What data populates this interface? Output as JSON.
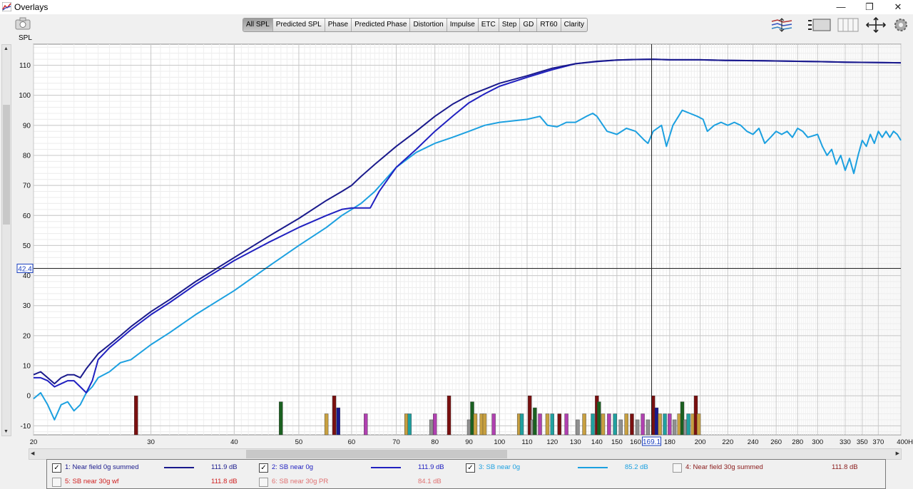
{
  "window": {
    "title": "Overlays",
    "buttons": {
      "minimize": "—",
      "restore": "❐",
      "close": "✕"
    }
  },
  "tabs": [
    {
      "label": "All SPL",
      "active": true
    },
    {
      "label": "Predicted SPL",
      "active": false
    },
    {
      "label": "Phase",
      "active": false
    },
    {
      "label": "Predicted Phase",
      "active": false
    },
    {
      "label": "Distortion",
      "active": false
    },
    {
      "label": "Impulse",
      "active": false
    },
    {
      "label": "ETC",
      "active": false
    },
    {
      "label": "Step",
      "active": false
    },
    {
      "label": "GD",
      "active": false
    },
    {
      "label": "RT60",
      "active": false
    },
    {
      "label": "Clarity",
      "active": false
    }
  ],
  "icons": [
    "camera-icon",
    "trace-arrange-icon",
    "controls-icon",
    "columns-icon",
    "move-icon",
    "gear-icon"
  ],
  "chart_data": {
    "type": "line",
    "ylabel": "SPL",
    "xscale": "log",
    "xlim": [
      20,
      400
    ],
    "ylim": [
      -13,
      117
    ],
    "yticks": [
      -10,
      0,
      10,
      20,
      30,
      40,
      50,
      60,
      70,
      80,
      90,
      100,
      110
    ],
    "xtick_labels": [
      "20",
      "30",
      "40",
      "50",
      "60",
      "70",
      "80",
      "90",
      "100",
      "110",
      "120",
      "130",
      "140",
      "150",
      "160",
      "180",
      "200",
      "220",
      "240",
      "260",
      "280",
      "300",
      "330",
      "350",
      "370",
      "400Hz"
    ],
    "xtick_values": [
      20,
      30,
      40,
      50,
      60,
      70,
      80,
      90,
      100,
      110,
      120,
      130,
      140,
      150,
      160,
      180,
      200,
      220,
      240,
      260,
      280,
      300,
      330,
      350,
      370,
      400
    ],
    "cursor": {
      "x": 169.1,
      "y": 42.4,
      "x_label": "169.1",
      "y_label": "42.4"
    },
    "grid": true,
    "series": [
      {
        "name": "1: Near field 0g summed",
        "color": "#1a1a8c",
        "points": [
          [
            20,
            7
          ],
          [
            20.5,
            8
          ],
          [
            21,
            6
          ],
          [
            21.5,
            4
          ],
          [
            22,
            6
          ],
          [
            22.5,
            7
          ],
          [
            23,
            7
          ],
          [
            23.5,
            6
          ],
          [
            24,
            9
          ],
          [
            25,
            14
          ],
          [
            26,
            17
          ],
          [
            27,
            20
          ],
          [
            28,
            23
          ],
          [
            30,
            28
          ],
          [
            32,
            32
          ],
          [
            35,
            38
          ],
          [
            40,
            46
          ],
          [
            45,
            53
          ],
          [
            50,
            59
          ],
          [
            55,
            65
          ],
          [
            58,
            68
          ],
          [
            60,
            70
          ],
          [
            62,
            73
          ],
          [
            65,
            77
          ],
          [
            70,
            83
          ],
          [
            75,
            88
          ],
          [
            80,
            93
          ],
          [
            85,
            97
          ],
          [
            90,
            100
          ],
          [
            95,
            102
          ],
          [
            100,
            104
          ],
          [
            110,
            106.5
          ],
          [
            120,
            109
          ],
          [
            130,
            110.5
          ],
          [
            140,
            111.3
          ],
          [
            150,
            111.7
          ],
          [
            160,
            111.9
          ],
          [
            170,
            112
          ],
          [
            180,
            111.8
          ],
          [
            190,
            111.8
          ],
          [
            200,
            111.8
          ],
          [
            220,
            111.6
          ],
          [
            250,
            111.5
          ],
          [
            280,
            111.3
          ],
          [
            300,
            111.2
          ],
          [
            330,
            111
          ],
          [
            370,
            110.9
          ],
          [
            400,
            110.8
          ]
        ]
      },
      {
        "name": "2: SB near 0g",
        "color": "#2020c0",
        "points": [
          [
            20,
            6
          ],
          [
            20.5,
            6
          ],
          [
            21,
            5
          ],
          [
            21.5,
            3
          ],
          [
            22,
            4
          ],
          [
            22.5,
            5
          ],
          [
            23,
            5
          ],
          [
            23.5,
            3
          ],
          [
            24,
            1
          ],
          [
            24.5,
            5
          ],
          [
            25,
            12
          ],
          [
            26,
            16
          ],
          [
            27,
            19
          ],
          [
            28,
            22
          ],
          [
            30,
            27
          ],
          [
            32,
            31
          ],
          [
            35,
            37
          ],
          [
            40,
            45
          ],
          [
            45,
            51
          ],
          [
            50,
            56
          ],
          [
            55,
            60
          ],
          [
            58,
            62
          ],
          [
            60,
            62.5
          ],
          [
            62,
            62.5
          ],
          [
            64,
            62.5
          ],
          [
            66,
            68
          ],
          [
            70,
            76
          ],
          [
            75,
            82
          ],
          [
            80,
            88
          ],
          [
            85,
            93
          ],
          [
            90,
            97.5
          ],
          [
            95,
            100.5
          ],
          [
            100,
            103
          ],
          [
            110,
            106
          ],
          [
            120,
            108.5
          ],
          [
            130,
            110.5
          ],
          [
            140,
            111.2
          ],
          [
            150,
            111.7
          ],
          [
            160,
            111.9
          ],
          [
            170,
            112
          ],
          [
            180,
            111.8
          ],
          [
            190,
            111.8
          ],
          [
            200,
            111.8
          ],
          [
            220,
            111.6
          ],
          [
            250,
            111.5
          ],
          [
            280,
            111.3
          ],
          [
            300,
            111.2
          ],
          [
            330,
            111
          ],
          [
            370,
            110.9
          ],
          [
            400,
            110.8
          ]
        ]
      },
      {
        "name": "3: SB near 0g",
        "color": "#1ca0e0",
        "points": [
          [
            20,
            -1
          ],
          [
            20.5,
            1
          ],
          [
            21,
            -3
          ],
          [
            21.5,
            -8
          ],
          [
            22,
            -3
          ],
          [
            22.5,
            -2
          ],
          [
            23,
            -5
          ],
          [
            23.5,
            -3
          ],
          [
            24,
            1
          ],
          [
            24.5,
            3
          ],
          [
            25,
            6
          ],
          [
            26,
            8
          ],
          [
            27,
            11
          ],
          [
            28,
            12
          ],
          [
            30,
            17
          ],
          [
            32,
            21
          ],
          [
            35,
            27
          ],
          [
            40,
            35
          ],
          [
            45,
            43
          ],
          [
            50,
            50
          ],
          [
            55,
            56
          ],
          [
            58,
            60
          ],
          [
            60,
            62
          ],
          [
            62,
            64
          ],
          [
            65,
            68
          ],
          [
            70,
            76
          ],
          [
            75,
            81
          ],
          [
            80,
            84
          ],
          [
            85,
            86
          ],
          [
            90,
            88
          ],
          [
            95,
            90
          ],
          [
            100,
            91
          ],
          [
            110,
            92
          ],
          [
            115,
            93
          ],
          [
            118,
            90
          ],
          [
            122,
            89.5
          ],
          [
            126,
            91
          ],
          [
            130,
            91
          ],
          [
            135,
            93
          ],
          [
            138,
            94
          ],
          [
            140,
            93
          ],
          [
            145,
            88
          ],
          [
            150,
            87
          ],
          [
            155,
            89
          ],
          [
            160,
            88
          ],
          [
            165,
            85
          ],
          [
            167,
            84
          ],
          [
            170,
            88
          ],
          [
            175,
            90
          ],
          [
            178,
            83
          ],
          [
            182,
            90
          ],
          [
            188,
            95
          ],
          [
            193,
            94
          ],
          [
            198,
            93
          ],
          [
            202,
            92
          ],
          [
            205,
            88
          ],
          [
            210,
            90
          ],
          [
            215,
            91
          ],
          [
            220,
            90
          ],
          [
            225,
            91
          ],
          [
            230,
            90
          ],
          [
            235,
            88
          ],
          [
            240,
            87
          ],
          [
            245,
            89
          ],
          [
            250,
            84
          ],
          [
            255,
            86
          ],
          [
            260,
            88
          ],
          [
            265,
            87
          ],
          [
            270,
            88
          ],
          [
            275,
            86
          ],
          [
            280,
            89
          ],
          [
            285,
            88
          ],
          [
            290,
            86
          ],
          [
            300,
            87
          ],
          [
            305,
            83
          ],
          [
            310,
            80
          ],
          [
            315,
            82
          ],
          [
            320,
            77
          ],
          [
            325,
            80
          ],
          [
            330,
            75
          ],
          [
            335,
            79
          ],
          [
            340,
            74
          ],
          [
            345,
            80
          ],
          [
            350,
            85
          ],
          [
            355,
            83
          ],
          [
            360,
            87
          ],
          [
            365,
            84
          ],
          [
            370,
            88
          ],
          [
            375,
            86
          ],
          [
            380,
            88
          ],
          [
            385,
            86
          ],
          [
            390,
            88
          ],
          [
            395,
            87
          ],
          [
            400,
            85
          ]
        ]
      }
    ],
    "bars": {
      "baseline": -13,
      "items": [
        {
          "x": 28.5,
          "top": 0,
          "color": "#7a1010"
        },
        {
          "x": 47,
          "top": -2,
          "color": "#1a6020"
        },
        {
          "x": 55,
          "top": -6,
          "color": "#c8a040"
        },
        {
          "x": 56.5,
          "top": 0,
          "color": "#7a1010"
        },
        {
          "x": 57.3,
          "top": -4,
          "color": "#1a1a8c"
        },
        {
          "x": 63,
          "top": -6,
          "color": "#b040b0"
        },
        {
          "x": 72.5,
          "top": -6,
          "color": "#c8a040"
        },
        {
          "x": 73.3,
          "top": -6,
          "color": "#20a0a0"
        },
        {
          "x": 79,
          "top": -8,
          "color": "#909090"
        },
        {
          "x": 80,
          "top": -6,
          "color": "#b040b0"
        },
        {
          "x": 84,
          "top": 0,
          "color": "#7a1010"
        },
        {
          "x": 90,
          "top": -8,
          "color": "#909090"
        },
        {
          "x": 91,
          "top": -2,
          "color": "#1a6020"
        },
        {
          "x": 92,
          "top": -6,
          "color": "#c8a040"
        },
        {
          "x": 94,
          "top": -6,
          "color": "#c8a040"
        },
        {
          "x": 95,
          "top": -6,
          "color": "#c8a040"
        },
        {
          "x": 98,
          "top": -6,
          "color": "#b040b0"
        },
        {
          "x": 107,
          "top": -6,
          "color": "#c8a040"
        },
        {
          "x": 108,
          "top": -6,
          "color": "#20a0a0"
        },
        {
          "x": 111,
          "top": 0,
          "color": "#7a1010"
        },
        {
          "x": 112,
          "top": -8,
          "color": "#909090"
        },
        {
          "x": 113,
          "top": -4,
          "color": "#1a6020"
        },
        {
          "x": 115,
          "top": -6,
          "color": "#b040b0"
        },
        {
          "x": 118,
          "top": -6,
          "color": "#c8a040"
        },
        {
          "x": 120,
          "top": -6,
          "color": "#20a0a0"
        },
        {
          "x": 123,
          "top": -6,
          "color": "#7a1010"
        },
        {
          "x": 126,
          "top": -6,
          "color": "#b040b0"
        },
        {
          "x": 131,
          "top": -8,
          "color": "#909090"
        },
        {
          "x": 134,
          "top": -6,
          "color": "#c8a040"
        },
        {
          "x": 138,
          "top": -6,
          "color": "#20a0a0"
        },
        {
          "x": 140,
          "top": 0,
          "color": "#7a1010"
        },
        {
          "x": 141,
          "top": -2,
          "color": "#1a6020"
        },
        {
          "x": 143,
          "top": -6,
          "color": "#c8a040"
        },
        {
          "x": 146,
          "top": -6,
          "color": "#b040b0"
        },
        {
          "x": 149,
          "top": -6,
          "color": "#20a0a0"
        },
        {
          "x": 152,
          "top": -8,
          "color": "#909090"
        },
        {
          "x": 155,
          "top": -6,
          "color": "#c8a040"
        },
        {
          "x": 158,
          "top": -6,
          "color": "#7a1010"
        },
        {
          "x": 161,
          "top": -8,
          "color": "#909090"
        },
        {
          "x": 164,
          "top": -6,
          "color": "#b040b0"
        },
        {
          "x": 167,
          "top": -8,
          "color": "#909090"
        },
        {
          "x": 170,
          "top": 0,
          "color": "#7a1010"
        },
        {
          "x": 172,
          "top": -4,
          "color": "#1a1a8c"
        },
        {
          "x": 174,
          "top": -6,
          "color": "#c8a040"
        },
        {
          "x": 177,
          "top": -6,
          "color": "#20a0a0"
        },
        {
          "x": 180,
          "top": -6,
          "color": "#b040b0"
        },
        {
          "x": 183,
          "top": -8,
          "color": "#909090"
        },
        {
          "x": 186,
          "top": -6,
          "color": "#c8a040"
        },
        {
          "x": 188,
          "top": -2,
          "color": "#1a6020"
        },
        {
          "x": 190,
          "top": -8,
          "color": "#909090"
        },
        {
          "x": 192,
          "top": -6,
          "color": "#20a0a0"
        },
        {
          "x": 195,
          "top": -6,
          "color": "#c8a040"
        },
        {
          "x": 197,
          "top": 0,
          "color": "#7a1010"
        },
        {
          "x": 199,
          "top": -6,
          "color": "#c8a040"
        }
      ]
    }
  },
  "legend": [
    {
      "label": "1: Near field 0g summed",
      "value": "111.9 dB",
      "checked": true,
      "color": "#1a1a8c",
      "line": true
    },
    {
      "label": "2: SB near 0g",
      "value": "111.9 dB",
      "checked": true,
      "color": "#2020c0",
      "line": true
    },
    {
      "label": "3: SB near 0g",
      "value": "85.2 dB",
      "checked": true,
      "color": "#1ca0e0",
      "line": true
    },
    {
      "label": "4: Near field 30g summed",
      "value": "111.8 dB",
      "checked": false,
      "color": "#8a1a1a",
      "line": false
    },
    {
      "label": "5: SB near 30g wf",
      "value": "111.8 dB",
      "checked": false,
      "color": "#d02020",
      "line": false
    },
    {
      "label": "6: SB near 30g PR",
      "value": "84.1 dB",
      "checked": false,
      "color": "#e07070",
      "line": false
    }
  ]
}
